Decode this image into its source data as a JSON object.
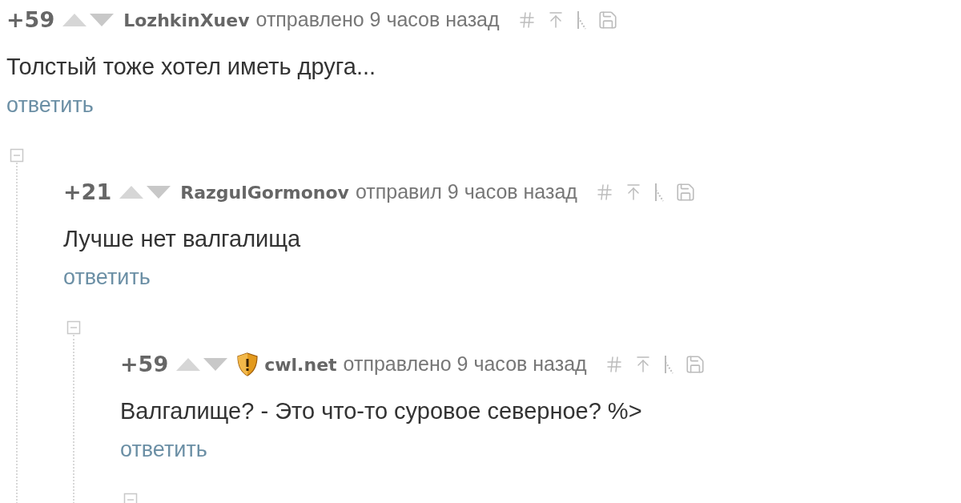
{
  "comments": [
    {
      "rating": "+59",
      "author": "LozhkinXuev",
      "badge": false,
      "time": "отправлено 9 часов назад",
      "text": "Толстый тоже хотел иметь друга...",
      "reply": "ответить",
      "expanded": true,
      "children": [
        {
          "rating": "+21",
          "author": "RazgulGormonov",
          "badge": false,
          "time": "отправил 9 часов назад",
          "text": "Лучше нет валгалища",
          "reply": "ответить",
          "expanded": true,
          "children": [
            {
              "rating": "+59",
              "author": "cwl.net",
              "badge": true,
              "time": "отправлено 9 часов назад",
              "text": "Валгалище? - Это что-то суровое северное? %>",
              "reply": "ответить",
              "expanded": true
            }
          ]
        }
      ]
    }
  ]
}
